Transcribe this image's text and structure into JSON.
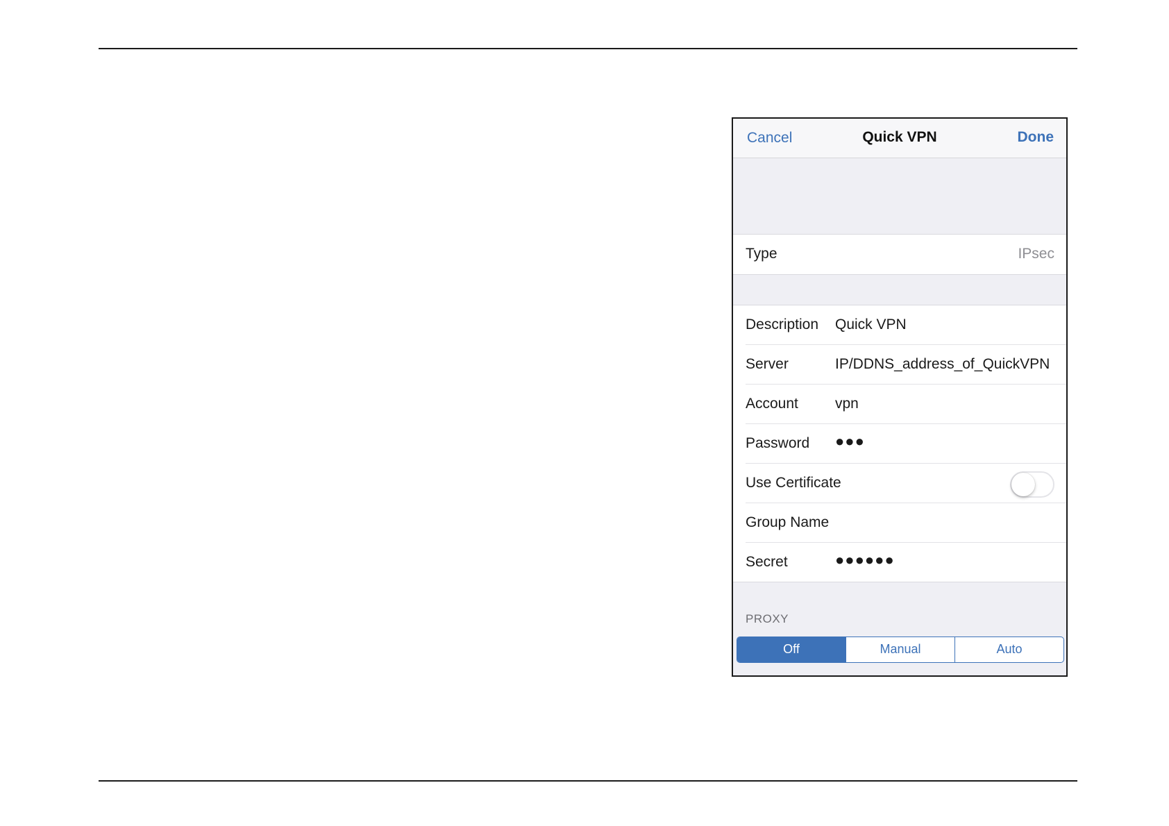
{
  "navbar": {
    "cancel_label": "Cancel",
    "title": "Quick VPN",
    "done_label": "Done"
  },
  "type_row": {
    "label": "Type",
    "value": "IPsec"
  },
  "fields": {
    "description": {
      "label": "Description",
      "value": "Quick VPN"
    },
    "server": {
      "label": "Server",
      "value": "IP/DDNS_address_of_QuickVPN"
    },
    "account": {
      "label": "Account",
      "value": "vpn"
    },
    "password": {
      "label": "Password",
      "value": "●●●"
    },
    "use_certificate": {
      "label": "Use Certificate",
      "enabled": false
    },
    "group_name": {
      "label": "Group Name",
      "value": ""
    },
    "secret": {
      "label": "Secret",
      "value": "●●●●●●"
    }
  },
  "proxy": {
    "header": "PROXY",
    "options": [
      "Off",
      "Manual",
      "Auto"
    ],
    "selected": "Off"
  },
  "colors": {
    "accent": "#3d72b8",
    "grouped_background": "#efeff4"
  }
}
